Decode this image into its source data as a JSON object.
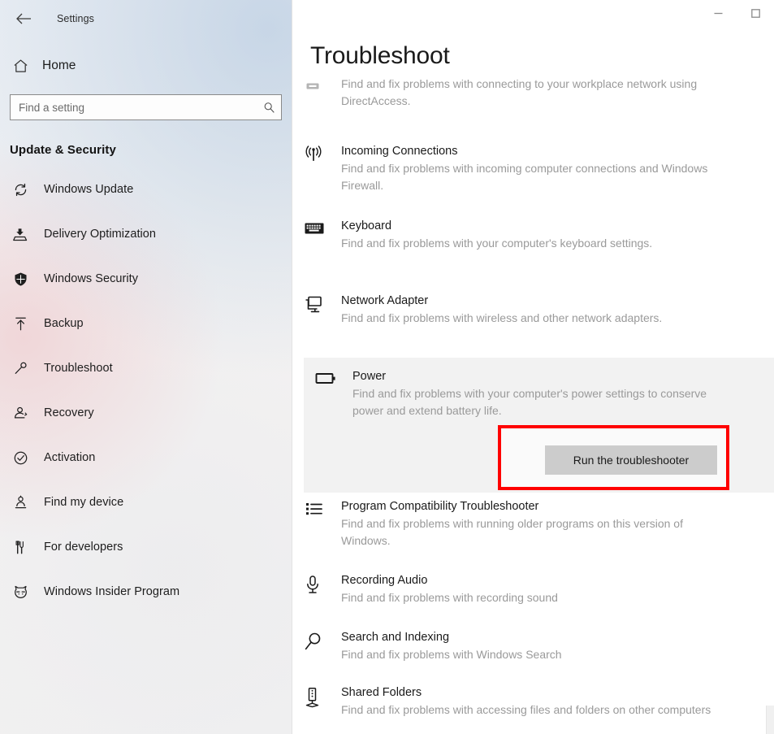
{
  "window": {
    "app_title": "Settings",
    "back_icon": "back-arrow-icon",
    "minimize_label": "–",
    "maximize_label": "☐"
  },
  "sidebar": {
    "home_label": "Home",
    "home_icon": "home-icon",
    "search": {
      "placeholder": "Find a setting",
      "value": "",
      "icon": "search-icon"
    },
    "section_heading": "Update & Security",
    "items": [
      {
        "label": "Windows Update",
        "icon": "sync-icon",
        "selected": false
      },
      {
        "label": "Delivery Optimization",
        "icon": "delivery-icon",
        "selected": false
      },
      {
        "label": "Windows Security",
        "icon": "shield-icon",
        "selected": false
      },
      {
        "label": "Backup",
        "icon": "upload-icon",
        "selected": false
      },
      {
        "label": "Troubleshoot",
        "icon": "wrench-icon",
        "selected": true
      },
      {
        "label": "Recovery",
        "icon": "recovery-icon",
        "selected": false
      },
      {
        "label": "Activation",
        "icon": "check-circle-icon",
        "selected": false
      },
      {
        "label": "Find my device",
        "icon": "locate-person-icon",
        "selected": false
      },
      {
        "label": "For developers",
        "icon": "tools-icon",
        "selected": false
      },
      {
        "label": "Windows Insider Program",
        "icon": "ninjacat-icon",
        "selected": false
      }
    ]
  },
  "main": {
    "page_title": "Troubleshoot",
    "run_button_label": "Run the troubleshooter",
    "highlight_color": "#ff0000",
    "troubleshooters": [
      {
        "title": "",
        "icon": "directaccess-icon",
        "desc": "Find and fix problems with connecting to your workplace network using DirectAccess.",
        "highlighted": false,
        "has_button": false
      },
      {
        "title": "Incoming Connections",
        "icon": "broadcast-icon",
        "desc": "Find and fix problems with incoming computer connections and Windows Firewall.",
        "highlighted": false,
        "has_button": false
      },
      {
        "title": "Keyboard",
        "icon": "keyboard-icon",
        "desc": "Find and fix problems with your computer's keyboard settings.",
        "highlighted": false,
        "has_button": false
      },
      {
        "title": "Network Adapter",
        "icon": "monitor-icon",
        "desc": "Find and fix problems with wireless and other network adapters.",
        "highlighted": false,
        "has_button": false
      },
      {
        "title": "Power",
        "icon": "battery-icon",
        "desc": "Find and fix problems with your computer's power settings to conserve power and extend battery life.",
        "highlighted": true,
        "has_button": true
      },
      {
        "title": "Program Compatibility Troubleshooter",
        "icon": "list-icon",
        "desc": "Find and fix problems with running older programs on this version of Windows.",
        "highlighted": false,
        "has_button": false
      },
      {
        "title": "Recording Audio",
        "icon": "microphone-icon",
        "desc": "Find and fix problems with recording sound",
        "highlighted": false,
        "has_button": false
      },
      {
        "title": "Search and Indexing",
        "icon": "magnifier-icon",
        "desc": "Find and fix problems with Windows Search",
        "highlighted": false,
        "has_button": false
      },
      {
        "title": "Shared Folders",
        "icon": "server-icon",
        "desc": "Find and fix problems with accessing files and folders on other computers",
        "highlighted": false,
        "has_button": false
      }
    ]
  }
}
